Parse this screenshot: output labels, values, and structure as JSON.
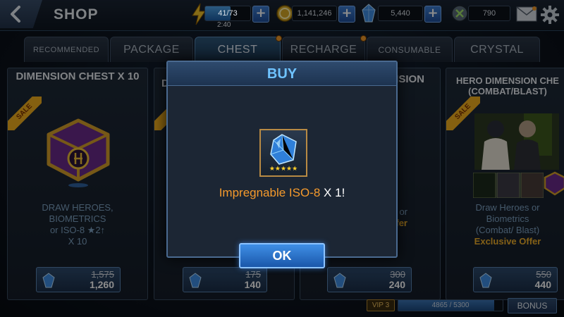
{
  "header": {
    "title": "SHOP",
    "energy": {
      "value": "41/73",
      "timer": "2:40",
      "fill_fraction": 0.56
    },
    "gold": {
      "value": "1,141,246"
    },
    "crystals": {
      "value": "5,440"
    },
    "third_currency": {
      "value": "790"
    },
    "icons": {
      "back": "back-arrow-icon",
      "energy": "lightning-icon",
      "gold": "gold-coin-icon",
      "crystal": "crystal-icon",
      "third": "shield-x-icon",
      "mail": "mail-icon",
      "settings": "gear-icon"
    }
  },
  "tabs": [
    {
      "label": "RECOMMENDED",
      "active": false,
      "dot": false
    },
    {
      "label": "PACKAGE",
      "active": false,
      "dot": false
    },
    {
      "label": "CHEST",
      "active": true,
      "dot": true
    },
    {
      "label": "RECHARGE",
      "active": false,
      "dot": true
    },
    {
      "label": "CONSUMABLE",
      "active": false,
      "dot": false
    },
    {
      "label": "CRYSTAL",
      "active": false,
      "dot": false
    }
  ],
  "cards": [
    {
      "title": "DIMENSION CHEST X 10",
      "sale": "SALE",
      "desc_lines": [
        "DRAW HEROES,",
        "BIOMETRICS",
        "or ISO-8 ★2↑",
        "X 10"
      ],
      "offer": "",
      "old_price": "1,575",
      "new_price": "1,260"
    },
    {
      "title": "D",
      "sale": "SA",
      "desc_lines": [],
      "offer": "",
      "old_price": "175",
      "new_price": "140"
    },
    {
      "title": "NSION",
      "sale": "",
      "desc_lines": [
        "or",
        ""
      ],
      "offer": "ffer",
      "old_price": "300",
      "new_price": "240"
    },
    {
      "title": "HERO DIMENSION CHE (COMBAT/BLAST)",
      "sale": "SALE",
      "desc_lines": [
        "Draw Heroes or",
        "Biometrics",
        "(Combat/ Blast)"
      ],
      "offer": "Exclusive Offer",
      "old_price": "550",
      "new_price": "440"
    }
  ],
  "modal": {
    "title": "BUY",
    "item_name": "Impregnable ISO-8",
    "item_qty": " X 1!",
    "stars": "★★★★★",
    "ok_label": "OK"
  },
  "footer": {
    "vip_label": "VIP 3",
    "vip_progress": "4865 / 5300",
    "vip_fraction": 0.918,
    "bonus_label": "BONUS"
  },
  "colors": {
    "accent_blue": "#6fc3ff",
    "item_orange": "#f59a2c",
    "sale_yellow": "#f2b01e",
    "offer_gold": "#f0b02a"
  }
}
